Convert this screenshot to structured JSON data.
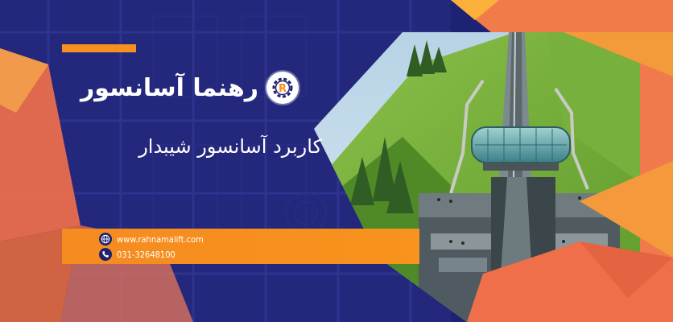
{
  "brand": {
    "name": "رهنما آسانسور",
    "logo_letter": "R"
  },
  "headline": "کاربرد آسانسور شیبدار",
  "contact": {
    "website": "www.rahnamalift.com",
    "phone": "031-32648100"
  },
  "colors": {
    "navy": "#1d2170",
    "orange": "#f7901e",
    "coral": "#ef6f4b",
    "yellow": "#fbb03b",
    "white": "#ffffff"
  },
  "icons": {
    "logo": "gear-logo-icon",
    "website": "globe-icon",
    "phone": "phone-icon"
  }
}
